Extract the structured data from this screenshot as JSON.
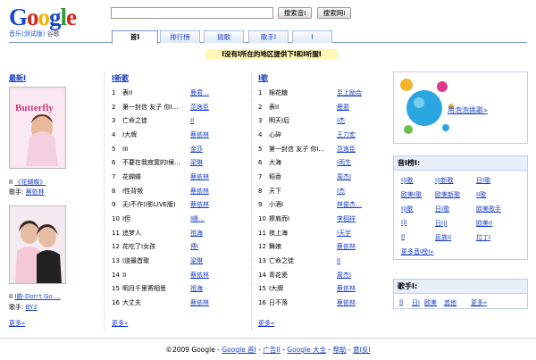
{
  "header": {
    "logo_text": "Google",
    "logo_sub": "音乐(测试版)",
    "logo_sub2": "谷歌",
    "search_value": "",
    "btn_music": "搜索音I",
    "btn_web": "搜索网I"
  },
  "tabs": [
    "首I",
    "排行榜",
    "挑歌",
    "歌手I",
    "I"
  ],
  "notice": "I没有I所在的地区提供下I和I听服I",
  "latest": {
    "title": "最新I",
    "album1_title": "《花蝴蝶》",
    "album1_artist_label": "歌手:",
    "album1_artist": "蔡依林",
    "album2_title": "I曲-Don't Go ...",
    "album2_artist_label": "歌手:",
    "album2_artist": "BY2",
    "more": "更多»"
  },
  "new_songs": {
    "title": "I新歌",
    "rows": [
      {
        "n": "1",
        "t": "表II",
        "a": "鹿君…"
      },
      {
        "n": "2",
        "t": "第一封信 友子 你I…",
        "a": "范逸臣"
      },
      {
        "n": "3",
        "t": "亡命之徒",
        "a": "II"
      },
      {
        "n": "4",
        "t": "I大牌",
        "a": "蔡依林"
      },
      {
        "n": "5",
        "t": "III",
        "a": "金莎"
      },
      {
        "n": "6",
        "t": "不要在我寂寞的I候…",
        "a": "梁琳"
      },
      {
        "n": "7",
        "t": "花蝴蝶",
        "a": "蔡依林"
      },
      {
        "n": "8",
        "t": "I性背叛",
        "a": "蔡依林"
      },
      {
        "n": "9",
        "t": "无I不作(I影LIVE版)",
        "a": "蔡依林"
      },
      {
        "n": "10",
        "t": "I但",
        "a": "I峰…"
      },
      {
        "n": "11",
        "t": "追梦人",
        "a": "祖海"
      },
      {
        "n": "12",
        "t": "花吃了I女孩",
        "a": "傅I"
      },
      {
        "n": "13",
        "t": "I道最首歌",
        "a": "梁琳"
      },
      {
        "n": "14",
        "t": "II",
        "a": "蔡依林"
      },
      {
        "n": "15",
        "t": "明月千里寄相思",
        "a": "祖海"
      },
      {
        "n": "16",
        "t": "大丈夫",
        "a": "蔡依林"
      }
    ],
    "more": "更多»"
  },
  "hot_songs": {
    "title": "I歌",
    "rows": [
      {
        "n": "1",
        "t": "棉花糖",
        "a": "至上励合"
      },
      {
        "n": "2",
        "t": "表II",
        "a": "鹿君"
      },
      {
        "n": "3",
        "t": "明天I后",
        "a": "I杰"
      },
      {
        "n": "4",
        "t": "心碎",
        "a": "王力宏"
      },
      {
        "n": "5",
        "t": "第一封信 友子 你I…",
        "a": "范逸臣"
      },
      {
        "n": "6",
        "t": "大海",
        "a": "I雨生"
      },
      {
        "n": "7",
        "t": "稻香",
        "a": "周杰I"
      },
      {
        "n": "8",
        "t": "天下",
        "a": "I杰"
      },
      {
        "n": "9",
        "t": "小酒I",
        "a": "林俊杰…"
      },
      {
        "n": "10",
        "t": "擦肩而I",
        "a": "李栩祥"
      },
      {
        "n": "11",
        "t": "夜上海",
        "a": "I天宇"
      },
      {
        "n": "12",
        "t": "舞娘",
        "a": "蔡依林"
      },
      {
        "n": "13",
        "t": "亡命之徒",
        "a": "II"
      },
      {
        "n": "14",
        "t": "青花瓷",
        "a": "周杰I"
      },
      {
        "n": "15",
        "t": "I大牌",
        "a": "蔡依林"
      },
      {
        "n": "16",
        "t": "日不落",
        "a": "蔡依林"
      }
    ],
    "more": "更多»"
  },
  "promo": {
    "text": "用泡泡挑歌»"
  },
  "genres": {
    "title": "音I榜I:",
    "items": [
      "I|I歌",
      "I|I新歌",
      "日I歌",
      "欧美I歌",
      "欧美新歌",
      "II歌",
      "I|I歌",
      "日I歌",
      "欧美歌手",
      "I|I",
      "日I|I",
      "欧美II",
      "II",
      "民族II",
      "拉丁I"
    ],
    "more": "更多音I榜I»"
  },
  "singers": {
    "title": "歌手I:",
    "items": [
      "II",
      "日I",
      "欧美",
      "其他"
    ],
    "more": "更多»"
  },
  "footer": {
    "copyright": "©2009  Google",
    "links": [
      "Google 首I",
      "广告II",
      "Google 大全",
      "帮助",
      "意I反I"
    ]
  },
  "colors": {
    "link": "#1a3fc4",
    "tab_border": "#7a95c8",
    "notice_bg": "#fff7b3",
    "panel_head": "#e8effb"
  }
}
